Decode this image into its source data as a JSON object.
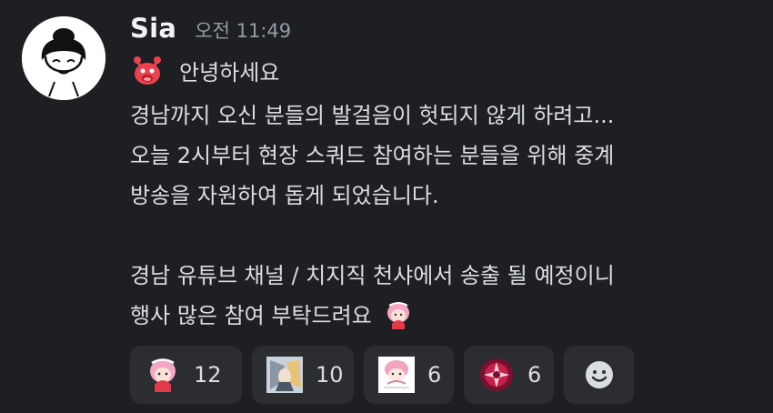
{
  "message": {
    "author": "Sia",
    "timestamp": "오전 11:49",
    "greeting": "안녕하세요",
    "lines": [
      "경남까지 오신 분들의 발걸음이 헛되지 않게 하려고...",
      "오늘 2시부터 현장 스쿼드 참여하는 분들을 위해 중계",
      "방송을 자원하여 돕게 되었습니다.",
      "",
      "경남 유튜브 채널 / 치지직 천샤에서 송출 될 예정이니",
      "행사 많은 참여 부탁드려요"
    ]
  },
  "reactions": [
    {
      "emoji": "pink-hair-girl-emoji",
      "count": "12"
    },
    {
      "emoji": "anime-character-emoji",
      "count": "10"
    },
    {
      "emoji": "pink-chibi-emoji",
      "count": "6"
    },
    {
      "emoji": "red-emblem-emoji",
      "count": "6"
    }
  ],
  "add_reaction_icon": "smiley-add-reaction-icon",
  "colors": {
    "background": "#1e1f22",
    "reaction_bg": "#2b2d31",
    "text": "#dbdee1",
    "muted": "#949ba4"
  }
}
